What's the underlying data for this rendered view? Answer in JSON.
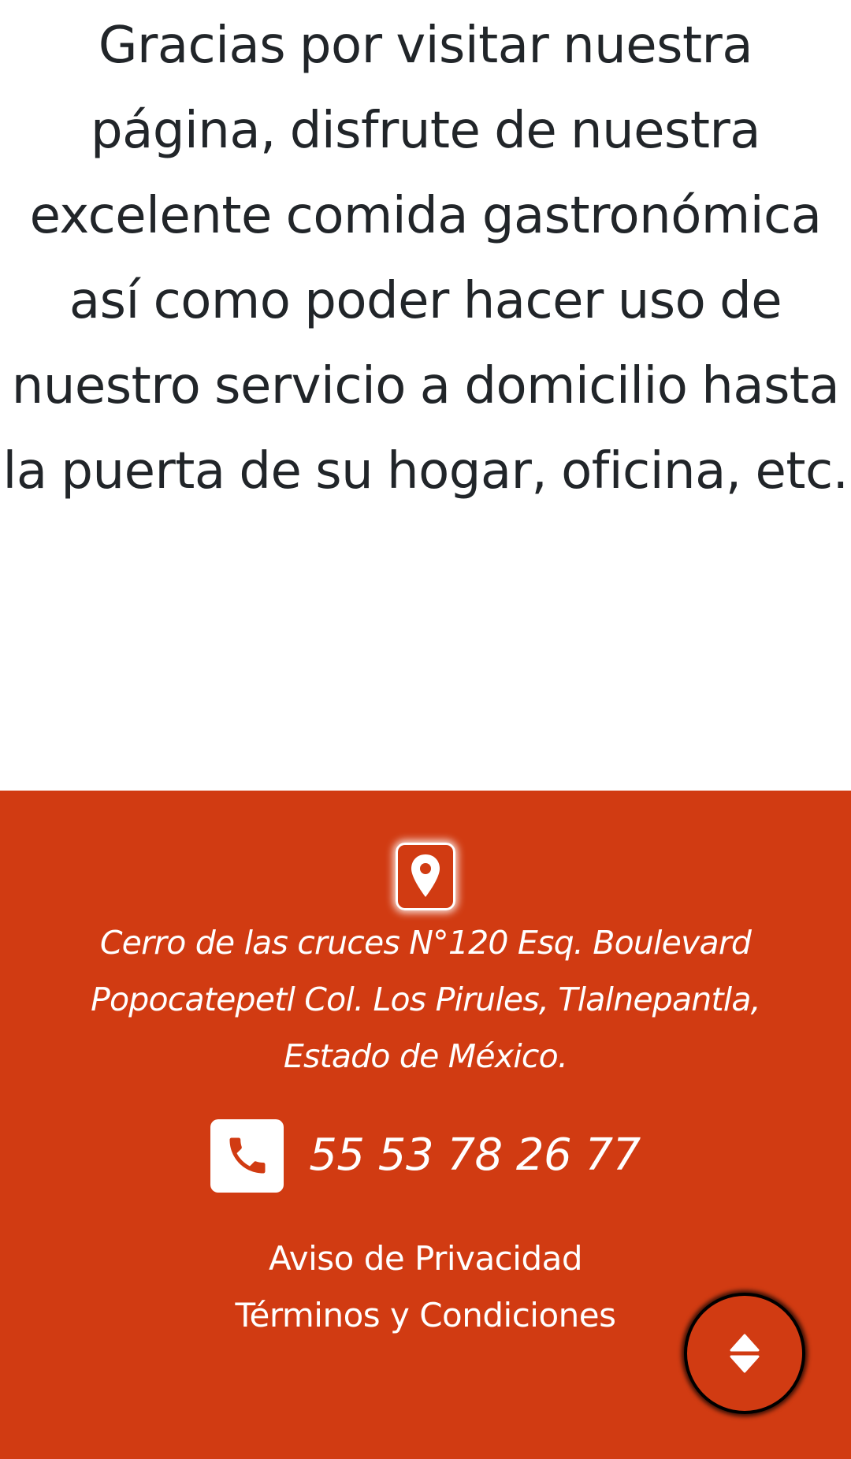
{
  "intro": {
    "message": "Gracias por visitar nuestra página, disfrute de nuestra excelente comida gastronómica así como poder hacer uso de nuestro servicio a domicilio hasta la puerta de su hogar, oficina, etc."
  },
  "footer": {
    "background_color": "#d13b12",
    "location_icon": "map-pin-icon",
    "address": "Cerro de las cruces N°120 Esq. Boulevard Popocatepetl Col. Los Pirules, Tlalnepantla, Estado de México.",
    "phone_icon": "phone-icon",
    "phone": "55 53 78 26 77",
    "links": [
      {
        "label": "Aviso de Privacidad"
      },
      {
        "label": "Términos y Condiciones"
      }
    ]
  },
  "scroll_button": {
    "icon": "sort-arrows-icon"
  }
}
